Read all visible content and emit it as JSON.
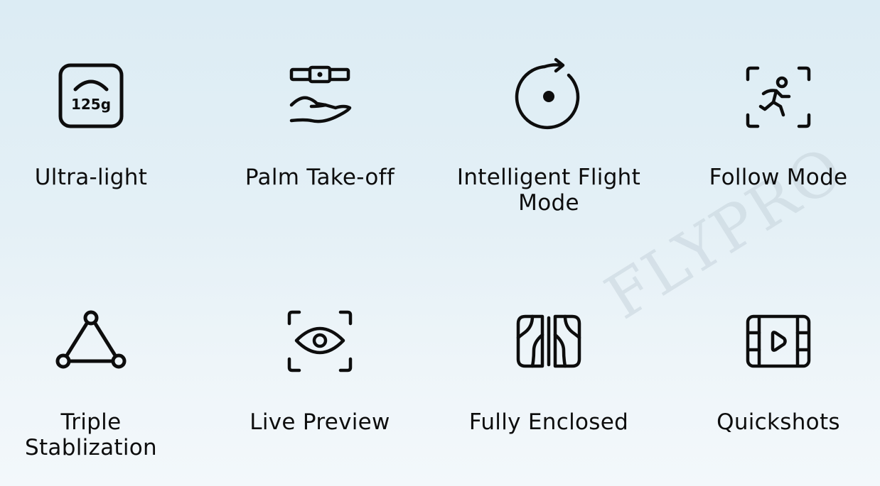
{
  "watermark": "FLYPRO",
  "features": [
    {
      "label_lines": [
        "Ultra-light"
      ],
      "icon": "weight-scale-icon",
      "icon_text": "125g"
    },
    {
      "label_lines": [
        "Palm Take-off"
      ],
      "icon": "palm-takeoff-icon"
    },
    {
      "label_lines": [
        "Intelligent Flight",
        "Mode"
      ],
      "icon": "intelligent-flight-icon"
    },
    {
      "label_lines": [
        "Follow Mode"
      ],
      "icon": "follow-mode-icon"
    },
    {
      "label_lines": [
        "Triple",
        "Stablization"
      ],
      "icon": "triple-stabilization-icon"
    },
    {
      "label_lines": [
        "Live Preview"
      ],
      "icon": "live-preview-icon"
    },
    {
      "label_lines": [
        "Fully Enclosed"
      ],
      "icon": "fully-enclosed-icon"
    },
    {
      "label_lines": [
        "Quickshots"
      ],
      "icon": "quickshots-icon"
    }
  ],
  "colors": {
    "icon_stroke": "#0d0d0d",
    "text": "#0d0d0d"
  }
}
